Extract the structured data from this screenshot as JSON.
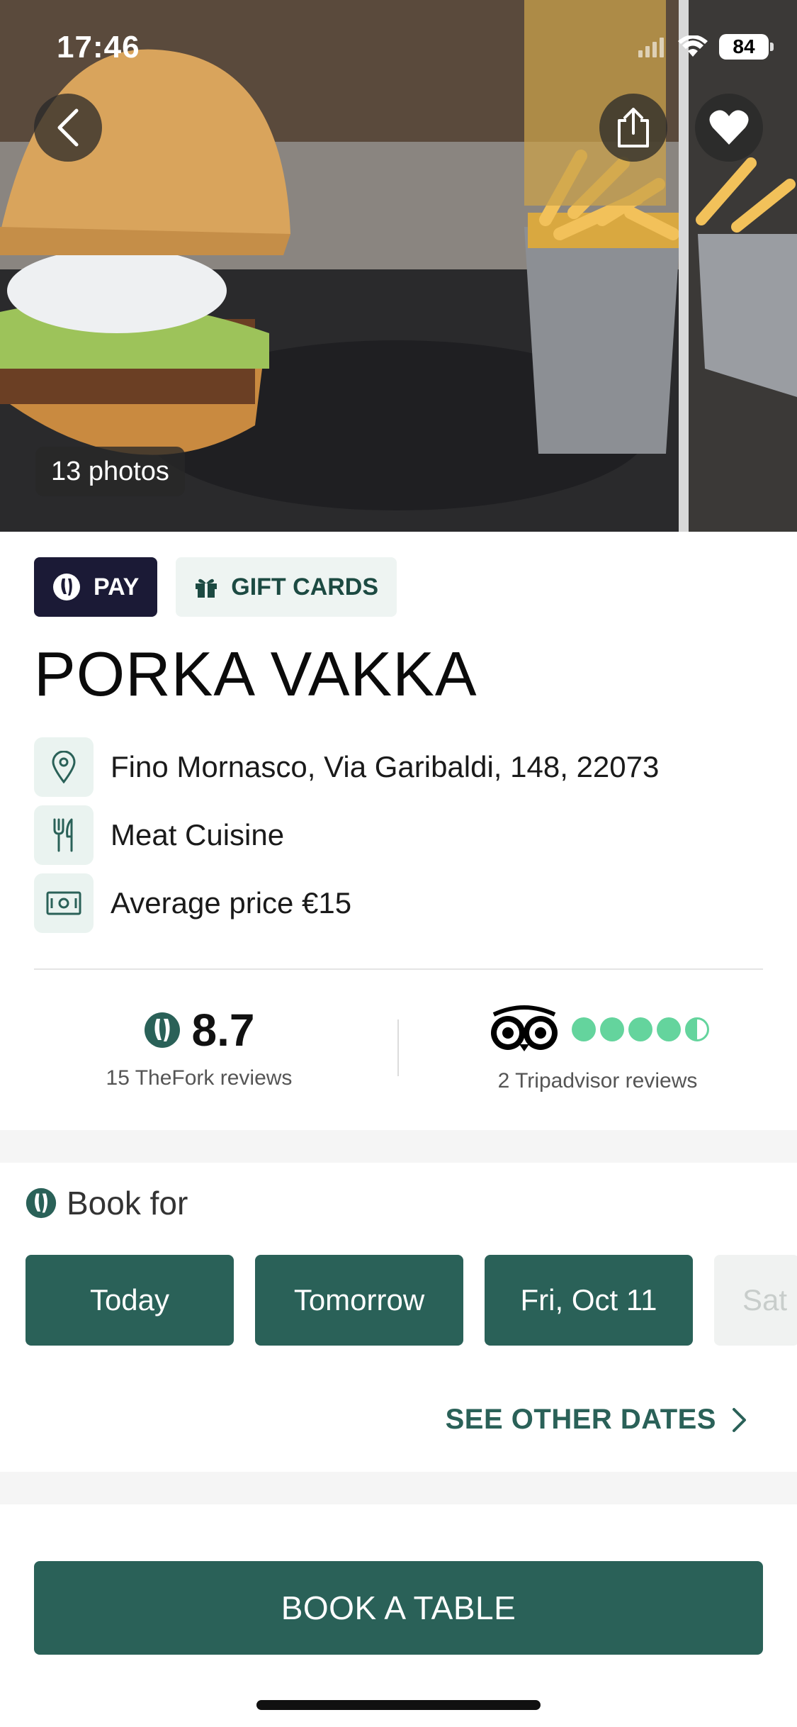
{
  "status_bar": {
    "time": "17:46",
    "battery": "84"
  },
  "hero": {
    "photo_count": "13 photos"
  },
  "tags": {
    "pay": "PAY",
    "gift_cards": "GIFT CARDS"
  },
  "restaurant": {
    "name": "PORKA VAKKA",
    "address": "Fino Mornasco, Via Garibaldi, 148, 22073",
    "cuisine": "Meat Cuisine",
    "average_price": "Average price €15"
  },
  "ratings": {
    "thefork_score": "8.7",
    "thefork_reviews": "15 TheFork reviews",
    "tripadvisor_bubbles": 4.5,
    "tripadvisor_reviews": "2 Tripadvisor reviews"
  },
  "booking": {
    "heading": "Book for",
    "dates": [
      "Today",
      "Tomorrow",
      "Fri, Oct 11",
      "Sat"
    ],
    "see_other": "SEE OTHER DATES",
    "cta": "BOOK A TABLE"
  },
  "colors": {
    "brand_green": "#2a6158",
    "pay_navy": "#1b1a36",
    "ta_green": "#64d49d"
  }
}
